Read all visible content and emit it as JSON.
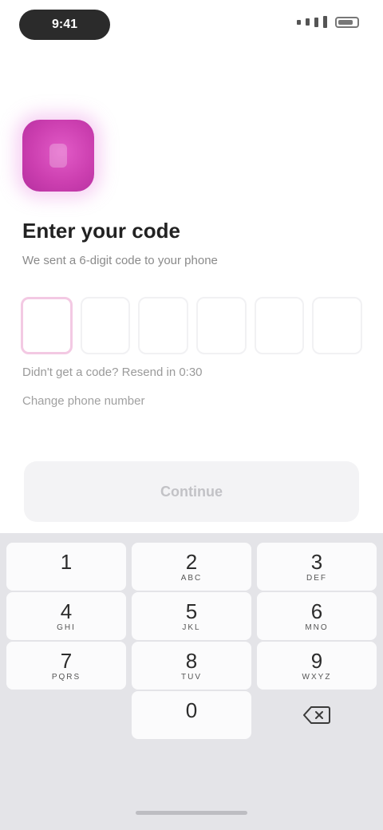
{
  "status_bar": {
    "time": "9:41"
  },
  "header": {
    "title": "Enter your code",
    "subtitle": "We sent a 6-digit code to your phone"
  },
  "code": {
    "digits": [
      "",
      "",
      "",
      "",
      "",
      ""
    ],
    "active_index": 0
  },
  "resend": {
    "text": "Didn't get a code? Resend in 0:30",
    "change_number_label": "Change phone number"
  },
  "actions": {
    "continue_label": "Continue"
  },
  "keyboard": {
    "keys": [
      {
        "num": "1",
        "letters": ""
      },
      {
        "num": "2",
        "letters": "ABC"
      },
      {
        "num": "3",
        "letters": "DEF"
      },
      {
        "num": "4",
        "letters": "GHI"
      },
      {
        "num": "5",
        "letters": "JKL"
      },
      {
        "num": "6",
        "letters": "MNO"
      },
      {
        "num": "7",
        "letters": "PQRS"
      },
      {
        "num": "8",
        "letters": "TUV"
      },
      {
        "num": "9",
        "letters": "WXYZ"
      },
      {
        "num": "0",
        "letters": ""
      }
    ],
    "delete_icon": "backspace-icon"
  },
  "colors": {
    "accent": "#cc3fb0",
    "active_box_border": "#f3c9e3"
  }
}
